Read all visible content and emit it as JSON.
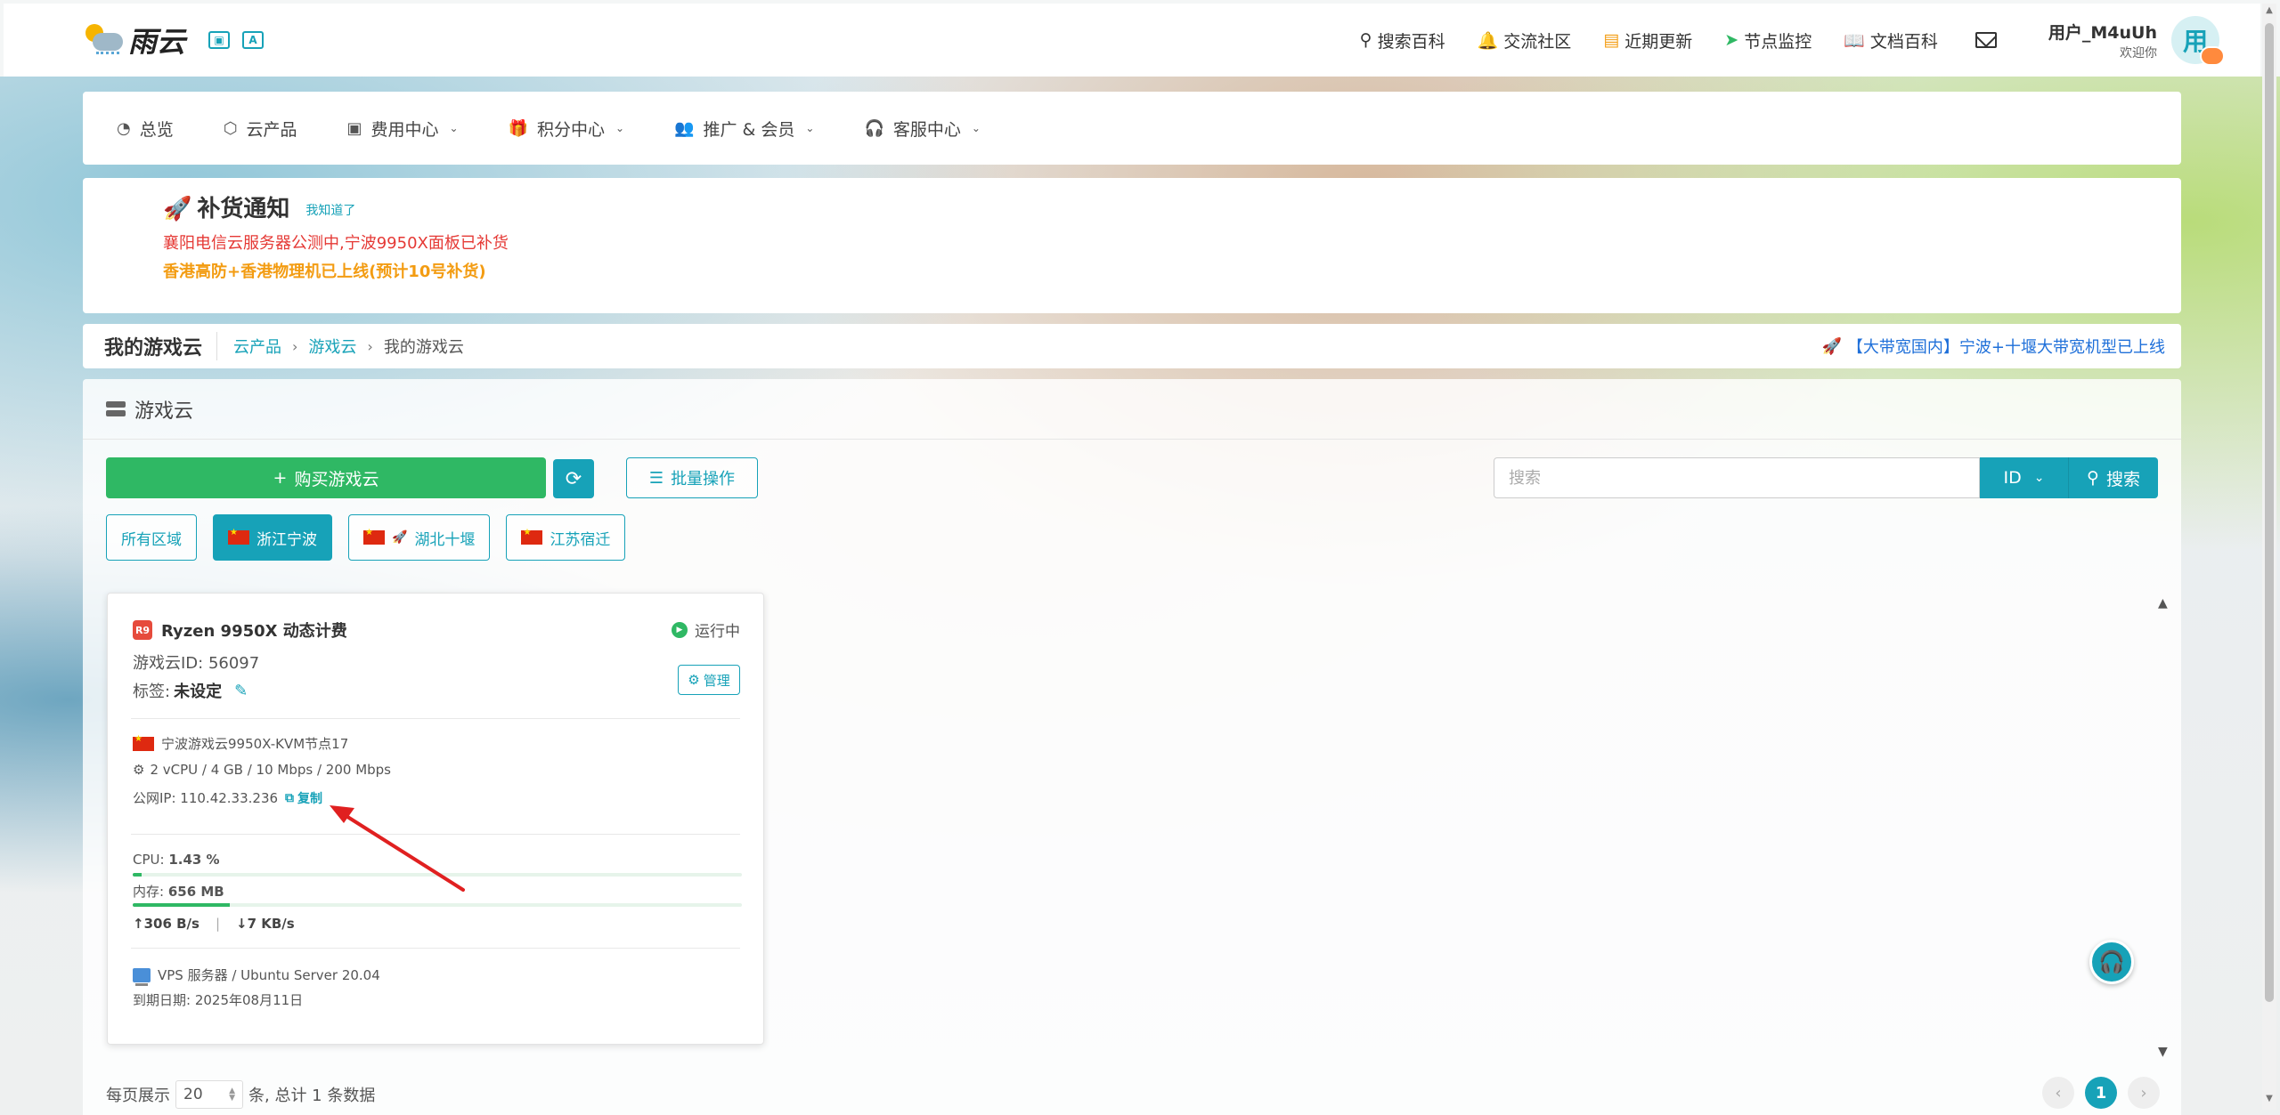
{
  "header": {
    "brand": "雨云",
    "nav": [
      {
        "label": "搜索百科",
        "icon": "search-icon"
      },
      {
        "label": "交流社区",
        "icon": "bell-icon"
      },
      {
        "label": "近期更新",
        "icon": "newspaper-icon"
      },
      {
        "label": "节点监控",
        "icon": "location-arrow-icon"
      },
      {
        "label": "文档百科",
        "icon": "book-icon"
      }
    ],
    "user_name": "用户_M4uUh",
    "user_greeting": "欢迎你",
    "avatar_char": "用"
  },
  "mainnav": {
    "items": [
      {
        "label": "总览",
        "icon": "dashboard-icon"
      },
      {
        "label": "云产品",
        "icon": "cubes-icon"
      },
      {
        "label": "费用中心",
        "icon": "money-icon",
        "dropdown": true
      },
      {
        "label": "积分中心",
        "icon": "gift-icon",
        "dropdown": true
      },
      {
        "label": "推广 & 会员",
        "icon": "users-icon",
        "dropdown": true
      },
      {
        "label": "客服中心",
        "icon": "headset-icon",
        "dropdown": true
      }
    ]
  },
  "notice": {
    "title": "补货通知",
    "ack": "我知道了",
    "line1": "襄阳电信云服务器公测中,宁波9950X面板已补货",
    "line2": "香港高防+香港物理机已上线(预计10号补货)"
  },
  "breadcrumb": {
    "title": "我的游戏云",
    "items": [
      "云产品",
      "游戏云",
      "我的游戏云"
    ],
    "announcement": "【大带宽国内】宁波+十堰大带宽机型已上线"
  },
  "content": {
    "section_title": "游戏云",
    "buy_label": "购买游戏云",
    "batch_label": "批量操作",
    "search_placeholder": "搜索",
    "search_field": "ID",
    "search_label": "搜索",
    "regions": [
      {
        "label": "所有区域",
        "flag": false,
        "active": false
      },
      {
        "label": "浙江宁波",
        "flag": true,
        "active": true
      },
      {
        "label": "湖北十堰",
        "flag": true,
        "active": false,
        "rocket": true
      },
      {
        "label": "江苏宿迁",
        "flag": true,
        "active": false
      }
    ]
  },
  "server": {
    "badge": "R9",
    "name": "Ryzen 9950X 动态计费",
    "status": "运行中",
    "id_line": "游戏云ID: 56097",
    "tag_label": "标签:",
    "tag_value": "未设定",
    "manage_label": "管理",
    "node": "宁波游戏云9950X-KVM节点17",
    "spec": "2 vCPU / 4 GB / 10 Mbps / 200 Mbps",
    "ip_label": "公网IP: 110.42.33.236",
    "copy_label": "复制",
    "cpu_label": "CPU: ",
    "cpu_value": "1.43 %",
    "cpu_fraction": 0.0143,
    "mem_label": "内存: ",
    "mem_value": "656 MB",
    "mem_fraction": 0.16,
    "net_up": "306 B/s",
    "net_down": "7 KB/s",
    "os": "VPS 服务器 / Ubuntu Server 20.04",
    "expire": "到期日期: 2025年08月11日"
  },
  "pagination": {
    "per_page_label": "每页展示",
    "per_page_value": "20",
    "summary": "条, 总计 1 条数据",
    "current_page": "1"
  },
  "colors": {
    "accent": "#17a2b8",
    "success": "#2fb864",
    "danger": "#e53935",
    "warning": "#f39c12",
    "link_blue": "#1e6fd9"
  }
}
